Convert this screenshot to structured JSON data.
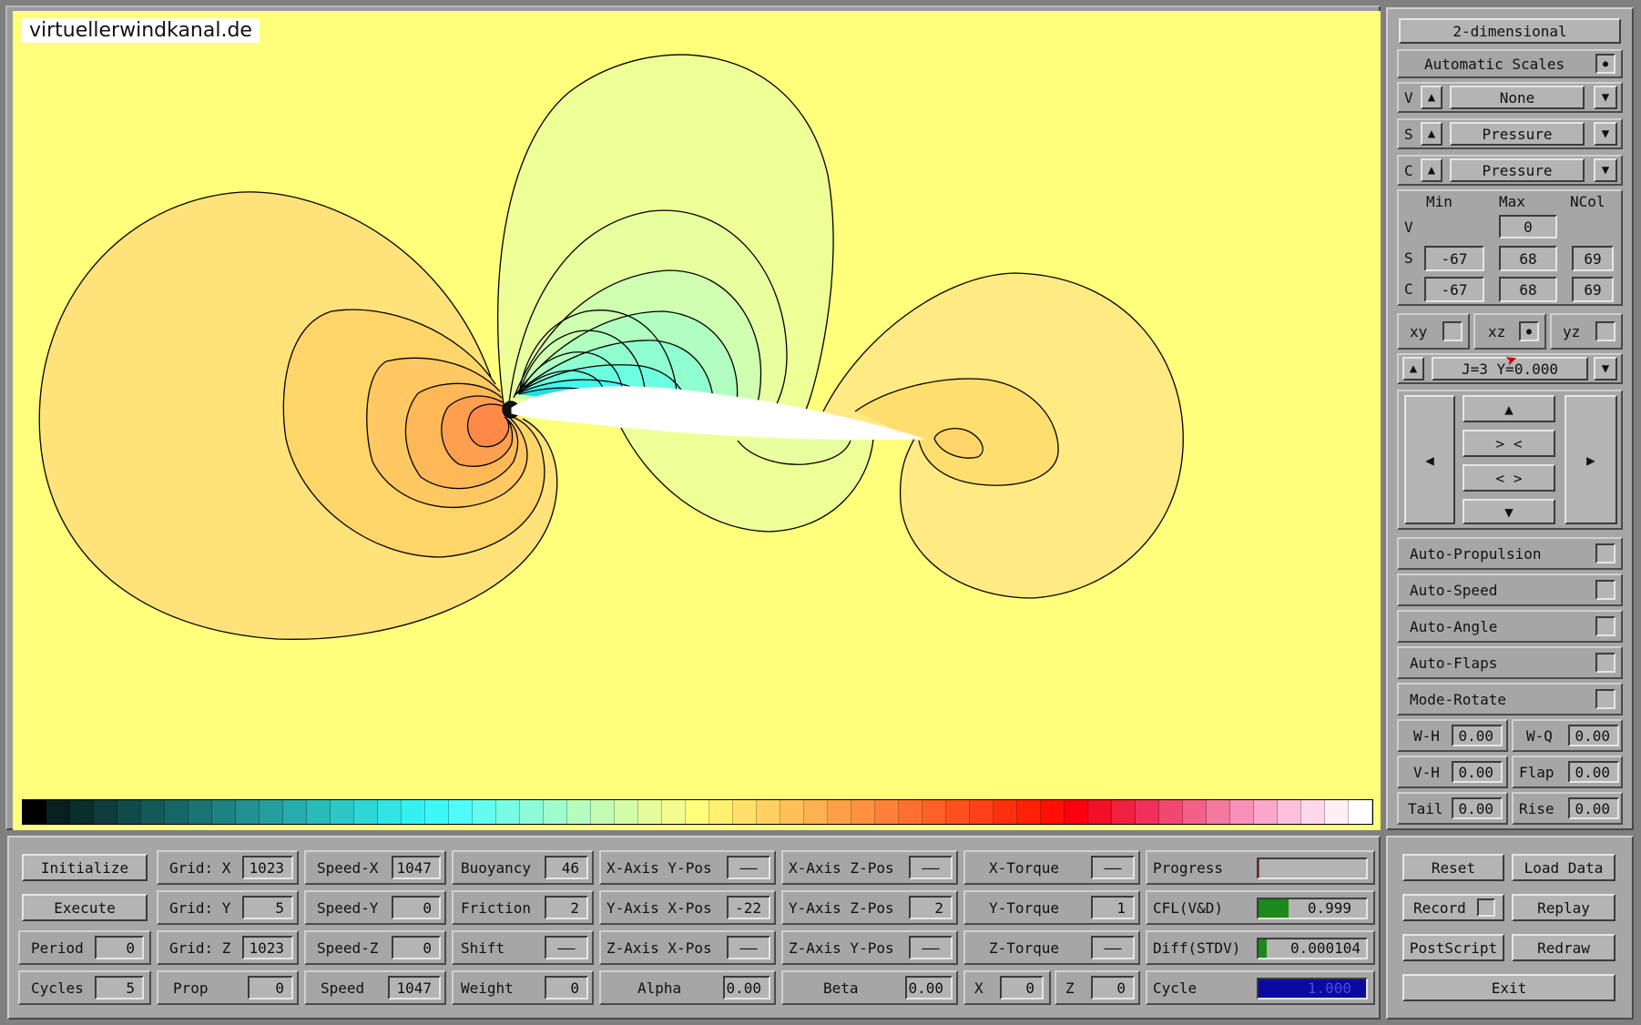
{
  "watermark": "virtuellerwindkanal.de",
  "colorbar": {
    "colors": [
      "#000000",
      "#062020",
      "#0a2e2e",
      "#0e3c3c",
      "#114a4a",
      "#145858",
      "#176666",
      "#1a7474",
      "#1d8282",
      "#209090",
      "#239e9e",
      "#26acac",
      "#29baba",
      "#2cc8c8",
      "#2fd6d6",
      "#32e4e4",
      "#35f0f0",
      "#3ef8f8",
      "#50fafa",
      "#64fbf0",
      "#78fbe4",
      "#8cfbd8",
      "#a0fccc",
      "#b4fcc0",
      "#c4fcb4",
      "#d4fca8",
      "#e4fc9c",
      "#f4fc90",
      "#ffff7c",
      "#fff070",
      "#ffe068",
      "#ffd060",
      "#ffc058",
      "#ffb050",
      "#ffa048",
      "#ff9040",
      "#ff8038",
      "#ff7030",
      "#ff6028",
      "#ff5020",
      "#ff4018",
      "#ff3010",
      "#ff2008",
      "#ff1000",
      "#f80010",
      "#f01028",
      "#f02040",
      "#f03058",
      "#f04870",
      "#f46088",
      "#f478a0",
      "#f890b8",
      "#fca8cc",
      "#fcc0dc",
      "#fcd8ea",
      "#fff0f6",
      "#ffffff"
    ]
  },
  "right_panel": {
    "dimension_button": "2-dimensional",
    "auto_scales": {
      "label": "Automatic Scales",
      "checked": true
    },
    "rows": [
      {
        "prefix": "V",
        "value": "None"
      },
      {
        "prefix": "S",
        "value": "Pressure"
      },
      {
        "prefix": "C",
        "value": "Pressure"
      }
    ],
    "scale_headers": [
      "Min",
      "Max",
      "NCol"
    ],
    "scales": {
      "V": {
        "max": "0"
      },
      "S": {
        "min": "-67",
        "max": "68",
        "ncol": "69"
      },
      "C": {
        "min": "-67",
        "max": "68",
        "ncol": "69"
      }
    },
    "planes": [
      {
        "label": "xy",
        "checked": false
      },
      {
        "label": "xz",
        "checked": true
      },
      {
        "label": "yz",
        "checked": false
      }
    ],
    "slice_label": "J=3  Y=0.000",
    "nav": {
      "up": "▲",
      "down": "▼",
      "left": "◀",
      "right": "▶",
      "zoom_in": "> <",
      "zoom_out": "< >"
    },
    "toggles": [
      {
        "label": "Auto-Propulsion",
        "checked": false
      },
      {
        "label": "Auto-Speed",
        "checked": false
      },
      {
        "label": "Auto-Angle",
        "checked": false
      },
      {
        "label": "Auto-Flaps",
        "checked": false
      },
      {
        "label": "Mode-Rotate",
        "checked": false
      }
    ],
    "params": [
      {
        "label": "W-H",
        "value": "0.00"
      },
      {
        "label": "W-Q",
        "value": "0.00"
      },
      {
        "label": "V-H",
        "value": "0.00"
      },
      {
        "label": "Flap",
        "value": "0.00"
      },
      {
        "label": "Tail",
        "value": "0.00"
      },
      {
        "label": "Rise",
        "value": "0.00"
      }
    ]
  },
  "bottom": {
    "actions": [
      "Initialize",
      "Execute"
    ],
    "period": {
      "label": "Period",
      "value": "0"
    },
    "cycles": {
      "label": "Cycles",
      "value": "5"
    },
    "grid": [
      {
        "label": "Grid: X",
        "value": "1023"
      },
      {
        "label": "Grid: Y",
        "value": "5"
      },
      {
        "label": "Grid: Z",
        "value": "1023"
      },
      {
        "label": "Prop",
        "value": "0"
      }
    ],
    "speed": [
      {
        "label": "Speed-X",
        "value": "1047"
      },
      {
        "label": "Speed-Y",
        "value": "0"
      },
      {
        "label": "Speed-Z",
        "value": "0"
      },
      {
        "label": "Speed",
        "value": "1047"
      }
    ],
    "physics": [
      {
        "label": "Buoyancy",
        "value": "46"
      },
      {
        "label": "Friction",
        "value": "2"
      },
      {
        "label": "Shift",
        "value": "——"
      },
      {
        "label": "Weight",
        "value": "0"
      }
    ],
    "axis_pos1": [
      {
        "label": "X-Axis Y-Pos",
        "value": "——"
      },
      {
        "label": "Y-Axis X-Pos",
        "value": "-22"
      },
      {
        "label": "Z-Axis X-Pos",
        "value": "——"
      },
      {
        "label": "Alpha",
        "value": "0.00"
      }
    ],
    "axis_pos2": [
      {
        "label": "X-Axis Z-Pos",
        "value": "——"
      },
      {
        "label": "Y-Axis Z-Pos",
        "value": "2"
      },
      {
        "label": "Z-Axis Y-Pos",
        "value": "——"
      },
      {
        "label": "Beta",
        "value": "0.00"
      }
    ],
    "torque": [
      {
        "label": "X-Torque",
        "value": "——"
      },
      {
        "label": "Y-Torque",
        "value": "1"
      },
      {
        "label": "Z-Torque",
        "value": "——"
      }
    ],
    "xz": [
      {
        "label": "X",
        "value": "0"
      },
      {
        "label": "Z",
        "value": "0"
      }
    ],
    "status": [
      {
        "label": "Progress",
        "value": "",
        "fill": 0.01,
        "color": "#c03030"
      },
      {
        "label": "CFL(V&D)",
        "value": "0.999",
        "fill": 0.28,
        "color": "#1a8a1a"
      },
      {
        "label": "Diff(STDV)",
        "value": "0.000104",
        "fill": 0.08,
        "color": "#1a8a1a"
      },
      {
        "label": "Cycle",
        "value": "1.000",
        "fill": 1.0,
        "color": "#0a0aa0"
      }
    ],
    "controls": [
      "Reset",
      "Load Data",
      "Record",
      "Replay",
      "PostScript",
      "Redraw",
      "Exit"
    ]
  }
}
